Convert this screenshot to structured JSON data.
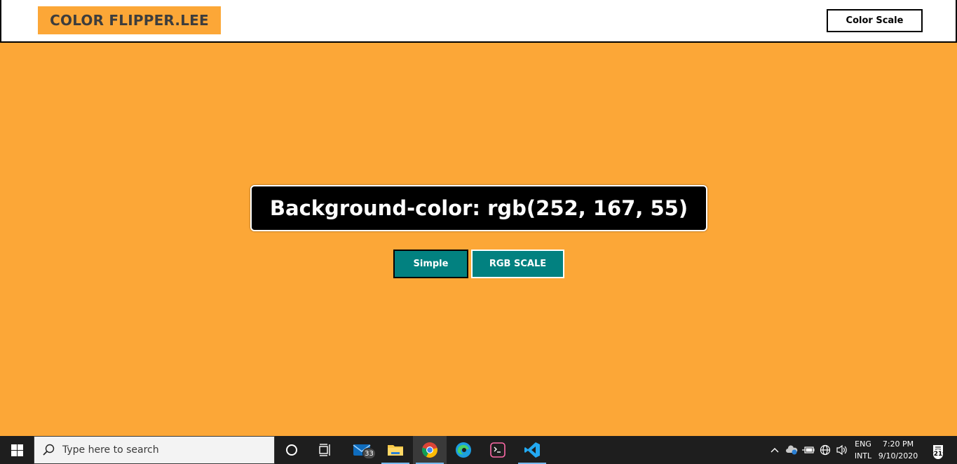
{
  "page": {
    "background_color": "#fca737",
    "accent_color": "#028180"
  },
  "header": {
    "logo_text": "COLOR FLIPPER.LEE",
    "nav_button_label": "Color Scale"
  },
  "main": {
    "display_text": "Background-color: rgb(252, 167, 55)",
    "simple_button_label": "Simple",
    "rgb_button_label": "RGB SCALE"
  },
  "taskbar": {
    "search_placeholder": "Type here to search",
    "apps": [
      {
        "name": "cortana",
        "icon": "cortana-circle-icon"
      },
      {
        "name": "task-view",
        "icon": "task-view-icon"
      },
      {
        "name": "mail",
        "icon": "mail-icon",
        "badge": "33"
      },
      {
        "name": "file-explorer",
        "icon": "folder-icon"
      },
      {
        "name": "chrome",
        "icon": "chrome-icon"
      },
      {
        "name": "edge",
        "icon": "edge-icon"
      },
      {
        "name": "terminal",
        "icon": "terminal-icon"
      },
      {
        "name": "vscode",
        "icon": "vscode-icon"
      }
    ],
    "language": {
      "line1": "ENG",
      "line2": "INTL"
    },
    "clock": {
      "time": "7:20 PM",
      "date": "9/10/2020"
    },
    "notification_count": "21"
  }
}
